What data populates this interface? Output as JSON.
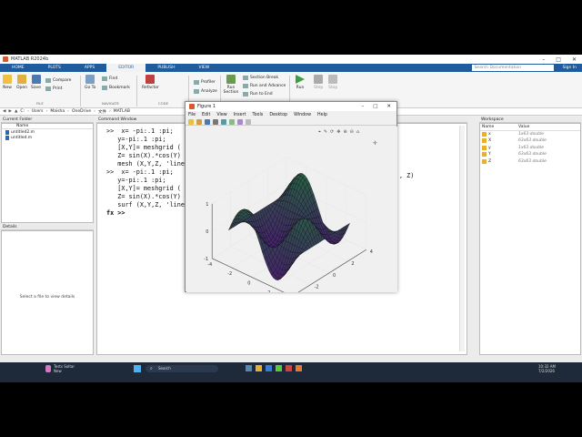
{
  "window": {
    "title": "MATLAB R2024b",
    "controls": [
      "–",
      "□",
      "✕"
    ]
  },
  "ribbon_tabs": [
    {
      "label": "HOME",
      "active": false
    },
    {
      "label": "PLOTS",
      "active": false
    },
    {
      "label": "APPS",
      "active": false
    },
    {
      "label": "EDITOR",
      "active": true
    },
    {
      "label": "PUBLISH",
      "active": false
    },
    {
      "label": "VIEW",
      "active": false
    }
  ],
  "search": {
    "placeholder": "Search Documentation"
  },
  "signin_label": "Sign In",
  "ribbon": {
    "file": {
      "new": "New",
      "open": "Open",
      "save": "Save",
      "compare": "Compare",
      "print": "Print",
      "group": "FILE"
    },
    "navigate": {
      "goto": "Go To",
      "find": "Find",
      "bookmark": "Bookmark",
      "group": "NAVIGATE"
    },
    "code": {
      "refactor": "Refactor",
      "group": "CODE"
    },
    "analyze": {
      "profiler": "Profiler",
      "analyze": "Analyze"
    },
    "section": {
      "run_section": "Run Section",
      "section_break": "Section Break",
      "run_advance": "Run and Advance",
      "run_end": "Run to End"
    },
    "run": {
      "run": "Run",
      "step": "Step",
      "stop": "Stop"
    }
  },
  "path": [
    "C:",
    "Users",
    "Maisha",
    "OneDrive",
    "文件",
    "MATLAB"
  ],
  "current_folder": {
    "title": "Current Folder",
    "column": "Name",
    "files": [
      "untitled2.m",
      "untitled.m"
    ]
  },
  "details": {
    "title": "Details",
    "empty": "Select a file to view details"
  },
  "command_window": {
    "title": "Command Window",
    "lines": [
      ">>  x= -pi:.1 :pi;",
      "   y=-pi:.1 :pi;",
      "   [X,Y]= meshgrid (",
      "   Z= sin(X).*cos(Y)",
      "   mesh (X,Y,Z, 'line",
      ">>  x= -pi:.1 :pi;",
      "   y=-pi:.1 :pi;",
      "   [X,Y]= meshgrid (",
      "   Z= sin(X).*cos(Y)",
      "   surf (X,Y,Z, 'line"
    ],
    "prompt": "fx >>",
    "cut_text": ", Z)"
  },
  "workspace": {
    "title": "Workspace",
    "columns": [
      "Name",
      "Value"
    ],
    "vars": [
      {
        "name": "x",
        "value": "1x63 double"
      },
      {
        "name": "X",
        "value": "63x63 double"
      },
      {
        "name": "y",
        "value": "1x63 double"
      },
      {
        "name": "Y",
        "value": "63x63 double"
      },
      {
        "name": "Z",
        "value": "63x63 double"
      }
    ]
  },
  "figure": {
    "title": "Figure 1",
    "menu": [
      "File",
      "Edit",
      "View",
      "Insert",
      "Tools",
      "Desktop",
      "Window",
      "Help"
    ]
  },
  "plot": {
    "z_ticks": [
      "1",
      "0",
      "-1"
    ],
    "x_ticks": [
      "-4",
      "-2",
      "0",
      "2",
      "4"
    ],
    "y_ticks": [
      "4",
      "2",
      "0",
      "-2",
      "-4"
    ]
  },
  "taskbar": {
    "weather": "Tests Soltar",
    "weather_sub": "New",
    "search": "Search",
    "time": "10:32 AM",
    "date": "7/2/2026"
  },
  "colors": {
    "ribbon_blue": "#1f5c9e",
    "accent": "#d9592b"
  }
}
